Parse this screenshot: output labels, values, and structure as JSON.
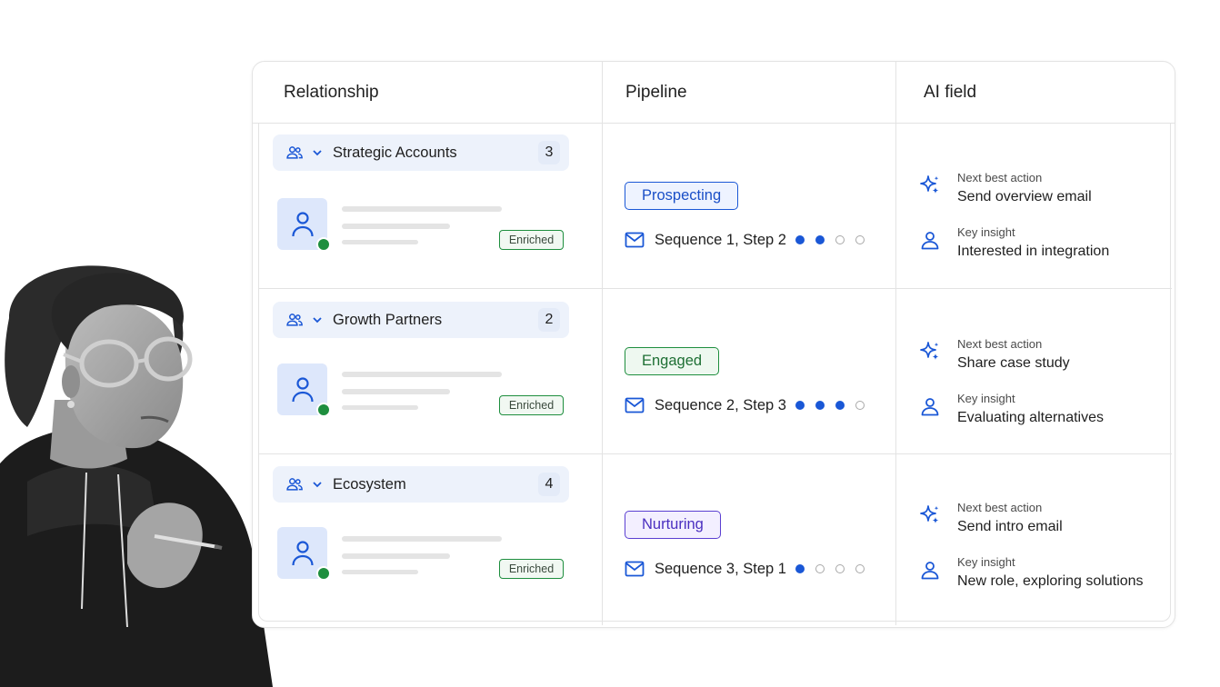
{
  "columns": {
    "relationship": "Relationship",
    "pipeline": "Pipeline",
    "ai_field": "AI field"
  },
  "rows": [
    {
      "group": "Strategic Accounts",
      "count": "3",
      "badge": "Enriched",
      "stage": "Prospecting",
      "stage_color": "#1a57d6",
      "sequence": "Sequence 1, Step 2",
      "progress": {
        "completed": 2,
        "total": 4
      },
      "next_label": "Next best action",
      "next_value": "Send overview email",
      "insight_label": "Key insight",
      "insight_value": "Interested in integration"
    },
    {
      "group": "Growth Partners",
      "count": "2",
      "badge": "Enriched",
      "stage": "Engaged",
      "stage_color": "#1e8e3e",
      "sequence": "Sequence 2, Step 3",
      "progress": {
        "completed": 3,
        "total": 4
      },
      "next_label": "Next best action",
      "next_value": "Share case study",
      "insight_label": "Key insight",
      "insight_value": "Evaluating alternatives"
    },
    {
      "group": "Ecosystem",
      "count": "4",
      "badge": "Enriched",
      "stage": "Nurturing",
      "stage_color": "#5a3fd1",
      "sequence": "Sequence 3, Step 1",
      "progress": {
        "completed": 1,
        "total": 4
      },
      "next_label": "Next best action",
      "next_value": "Send intro email",
      "insight_label": "Key insight",
      "insight_value": "New role, exploring solutions"
    }
  ],
  "icons": {
    "group": "people-icon",
    "expand": "chevron-down-icon",
    "contact": "person-icon",
    "status": "online-dot",
    "sequence": "mail-icon",
    "ai": "sparkle-icon",
    "insight": "person-outline-icon"
  },
  "colors": {
    "accent": "#1a57d6",
    "success": "#1e8e3e",
    "purple": "#5a3fd1"
  }
}
